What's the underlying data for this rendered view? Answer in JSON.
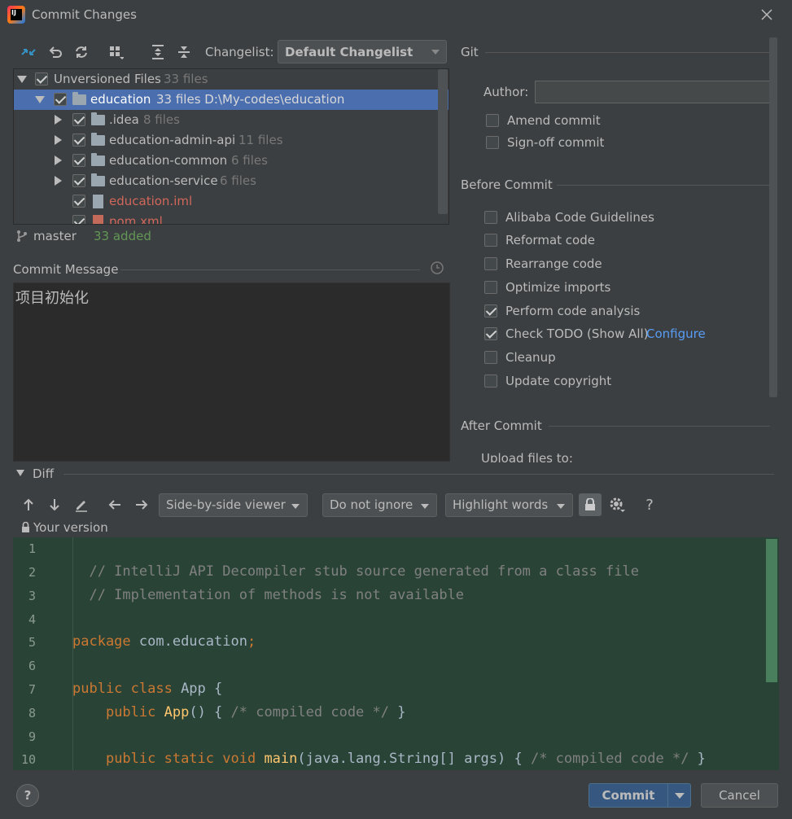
{
  "window": {
    "title": "Commit Changes"
  },
  "toolbar": {
    "changelist_label": "Changelist:",
    "changelist_value": "Default Changelist",
    "icons": [
      "compare-icon",
      "rollback-icon",
      "refresh-icon",
      "group-by-icon",
      "expand-all-icon",
      "collapse-all-icon"
    ]
  },
  "tree": {
    "rows": [
      {
        "name": "Unversioned Files",
        "meta": "33 files",
        "checked": true
      },
      {
        "name": "education",
        "meta": "33 files  D:\\My-codes\\education",
        "checked": true,
        "selected": true
      },
      {
        "name": ".idea",
        "meta": "8 files",
        "checked": true
      },
      {
        "name": "education-admin-api",
        "meta": "11 files",
        "checked": true
      },
      {
        "name": "education-common",
        "meta": "6 files",
        "checked": true
      },
      {
        "name": "education-service",
        "meta": "6 files",
        "checked": true
      },
      {
        "name": "education.iml",
        "meta": "",
        "checked": true
      },
      {
        "name": "pom.xml",
        "meta": "",
        "checked": true
      }
    ]
  },
  "status": {
    "branch": "master",
    "added": "33 added"
  },
  "commit_message": {
    "label": "Commit Message",
    "value": "项目初始化"
  },
  "git": {
    "header": "Git",
    "author_label": "Author:",
    "author_value": "",
    "amend": "Amend commit",
    "signoff": "Sign-off commit"
  },
  "before_commit": {
    "header": "Before Commit",
    "options": [
      {
        "label": "Alibaba Code Guidelines",
        "checked": false
      },
      {
        "label": "Reformat code",
        "checked": false
      },
      {
        "label": "Rearrange code",
        "checked": false
      },
      {
        "label": "Optimize imports",
        "checked": false
      },
      {
        "label": "Perform code analysis",
        "checked": true
      },
      {
        "label": "Check TODO (Show All)",
        "checked": true,
        "link": "Configure"
      },
      {
        "label": "Cleanup",
        "checked": false
      },
      {
        "label": "Update copyright",
        "checked": false
      }
    ]
  },
  "after_commit": {
    "header": "After Commit",
    "upload_label": "Upload files to:"
  },
  "diff": {
    "label": "Diff",
    "viewer": "Side-by-side viewer",
    "ignore": "Do not ignore",
    "highlight": "Highlight words",
    "version_label": "Your version",
    "help": "?"
  },
  "editor": {
    "line_numbers": [
      "1",
      "2",
      "3",
      "4",
      "5",
      "6",
      "7",
      "8",
      "9",
      "10"
    ],
    "lines": [
      "",
      "  // IntelliJ API Decompiler stub source generated from a class file",
      "  // Implementation of methods is not available",
      "",
      "package com.education;",
      "",
      "public class App {",
      "    public App() { /* compiled code */ }",
      "",
      "    public static void main(java.lang.String[] args) { /* compiled code */ }"
    ]
  },
  "footer": {
    "help": "?",
    "commit": "Commit",
    "cancel": "Cancel"
  },
  "colors": {
    "background": "#3c3f41",
    "selection": "#4b6eaf",
    "editor_bg": "#294436",
    "link": "#589df6",
    "added": "#629755",
    "unversioned": "#d1675a"
  }
}
